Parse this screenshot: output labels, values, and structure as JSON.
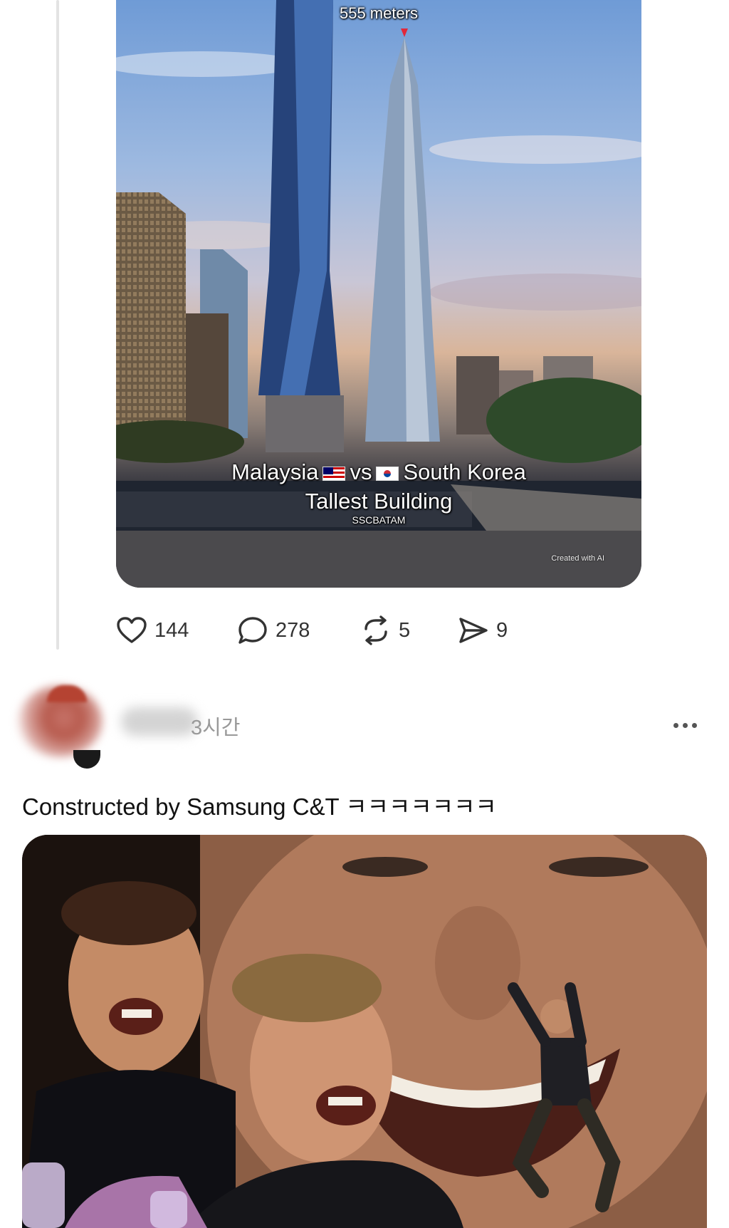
{
  "post": {
    "image": {
      "height_label": "555 meters",
      "title_left": "Malaysia",
      "title_vs": "vs",
      "title_right": "South Korea",
      "title_line2": "Tallest Building",
      "handle": "SSCBATAM",
      "credit": "Created with AI"
    },
    "actions": {
      "likes": "144",
      "replies": "278",
      "reposts": "5",
      "shares": "9"
    }
  },
  "reply": {
    "time": "3시간",
    "text": "Constructed by Samsung C&T ㅋㅋㅋㅋㅋㅋㅋ"
  },
  "icons": {
    "like": "heart-icon",
    "reply": "comment-bubble-icon",
    "repost": "repost-arrows-icon",
    "share": "paper-plane-icon",
    "more": "more-dots-icon"
  }
}
